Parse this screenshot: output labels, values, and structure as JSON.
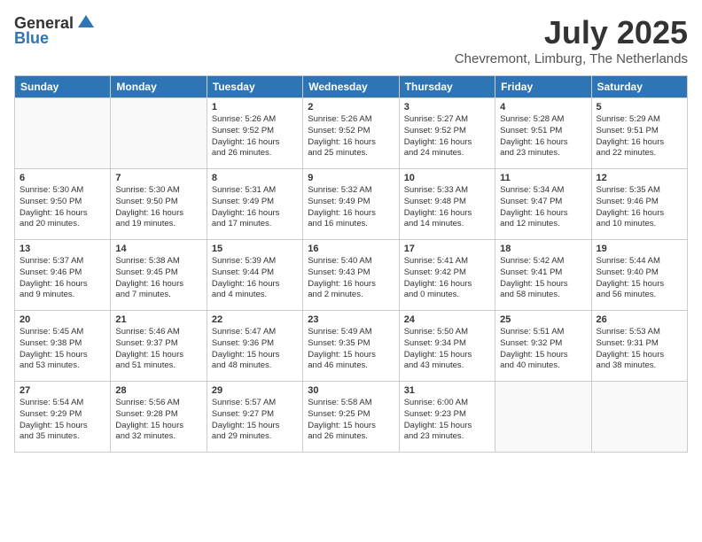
{
  "header": {
    "logo_general": "General",
    "logo_blue": "Blue",
    "month_year": "July 2025",
    "location": "Chevremont, Limburg, The Netherlands"
  },
  "weekdays": [
    "Sunday",
    "Monday",
    "Tuesday",
    "Wednesday",
    "Thursday",
    "Friday",
    "Saturday"
  ],
  "weeks": [
    [
      {
        "day": "",
        "detail": ""
      },
      {
        "day": "",
        "detail": ""
      },
      {
        "day": "1",
        "detail": "Sunrise: 5:26 AM\nSunset: 9:52 PM\nDaylight: 16 hours\nand 26 minutes."
      },
      {
        "day": "2",
        "detail": "Sunrise: 5:26 AM\nSunset: 9:52 PM\nDaylight: 16 hours\nand 25 minutes."
      },
      {
        "day": "3",
        "detail": "Sunrise: 5:27 AM\nSunset: 9:52 PM\nDaylight: 16 hours\nand 24 minutes."
      },
      {
        "day": "4",
        "detail": "Sunrise: 5:28 AM\nSunset: 9:51 PM\nDaylight: 16 hours\nand 23 minutes."
      },
      {
        "day": "5",
        "detail": "Sunrise: 5:29 AM\nSunset: 9:51 PM\nDaylight: 16 hours\nand 22 minutes."
      }
    ],
    [
      {
        "day": "6",
        "detail": "Sunrise: 5:30 AM\nSunset: 9:50 PM\nDaylight: 16 hours\nand 20 minutes."
      },
      {
        "day": "7",
        "detail": "Sunrise: 5:30 AM\nSunset: 9:50 PM\nDaylight: 16 hours\nand 19 minutes."
      },
      {
        "day": "8",
        "detail": "Sunrise: 5:31 AM\nSunset: 9:49 PM\nDaylight: 16 hours\nand 17 minutes."
      },
      {
        "day": "9",
        "detail": "Sunrise: 5:32 AM\nSunset: 9:49 PM\nDaylight: 16 hours\nand 16 minutes."
      },
      {
        "day": "10",
        "detail": "Sunrise: 5:33 AM\nSunset: 9:48 PM\nDaylight: 16 hours\nand 14 minutes."
      },
      {
        "day": "11",
        "detail": "Sunrise: 5:34 AM\nSunset: 9:47 PM\nDaylight: 16 hours\nand 12 minutes."
      },
      {
        "day": "12",
        "detail": "Sunrise: 5:35 AM\nSunset: 9:46 PM\nDaylight: 16 hours\nand 10 minutes."
      }
    ],
    [
      {
        "day": "13",
        "detail": "Sunrise: 5:37 AM\nSunset: 9:46 PM\nDaylight: 16 hours\nand 9 minutes."
      },
      {
        "day": "14",
        "detail": "Sunrise: 5:38 AM\nSunset: 9:45 PM\nDaylight: 16 hours\nand 7 minutes."
      },
      {
        "day": "15",
        "detail": "Sunrise: 5:39 AM\nSunset: 9:44 PM\nDaylight: 16 hours\nand 4 minutes."
      },
      {
        "day": "16",
        "detail": "Sunrise: 5:40 AM\nSunset: 9:43 PM\nDaylight: 16 hours\nand 2 minutes."
      },
      {
        "day": "17",
        "detail": "Sunrise: 5:41 AM\nSunset: 9:42 PM\nDaylight: 16 hours\nand 0 minutes."
      },
      {
        "day": "18",
        "detail": "Sunrise: 5:42 AM\nSunset: 9:41 PM\nDaylight: 15 hours\nand 58 minutes."
      },
      {
        "day": "19",
        "detail": "Sunrise: 5:44 AM\nSunset: 9:40 PM\nDaylight: 15 hours\nand 56 minutes."
      }
    ],
    [
      {
        "day": "20",
        "detail": "Sunrise: 5:45 AM\nSunset: 9:38 PM\nDaylight: 15 hours\nand 53 minutes."
      },
      {
        "day": "21",
        "detail": "Sunrise: 5:46 AM\nSunset: 9:37 PM\nDaylight: 15 hours\nand 51 minutes."
      },
      {
        "day": "22",
        "detail": "Sunrise: 5:47 AM\nSunset: 9:36 PM\nDaylight: 15 hours\nand 48 minutes."
      },
      {
        "day": "23",
        "detail": "Sunrise: 5:49 AM\nSunset: 9:35 PM\nDaylight: 15 hours\nand 46 minutes."
      },
      {
        "day": "24",
        "detail": "Sunrise: 5:50 AM\nSunset: 9:34 PM\nDaylight: 15 hours\nand 43 minutes."
      },
      {
        "day": "25",
        "detail": "Sunrise: 5:51 AM\nSunset: 9:32 PM\nDaylight: 15 hours\nand 40 minutes."
      },
      {
        "day": "26",
        "detail": "Sunrise: 5:53 AM\nSunset: 9:31 PM\nDaylight: 15 hours\nand 38 minutes."
      }
    ],
    [
      {
        "day": "27",
        "detail": "Sunrise: 5:54 AM\nSunset: 9:29 PM\nDaylight: 15 hours\nand 35 minutes."
      },
      {
        "day": "28",
        "detail": "Sunrise: 5:56 AM\nSunset: 9:28 PM\nDaylight: 15 hours\nand 32 minutes."
      },
      {
        "day": "29",
        "detail": "Sunrise: 5:57 AM\nSunset: 9:27 PM\nDaylight: 15 hours\nand 29 minutes."
      },
      {
        "day": "30",
        "detail": "Sunrise: 5:58 AM\nSunset: 9:25 PM\nDaylight: 15 hours\nand 26 minutes."
      },
      {
        "day": "31",
        "detail": "Sunrise: 6:00 AM\nSunset: 9:23 PM\nDaylight: 15 hours\nand 23 minutes."
      },
      {
        "day": "",
        "detail": ""
      },
      {
        "day": "",
        "detail": ""
      }
    ]
  ]
}
